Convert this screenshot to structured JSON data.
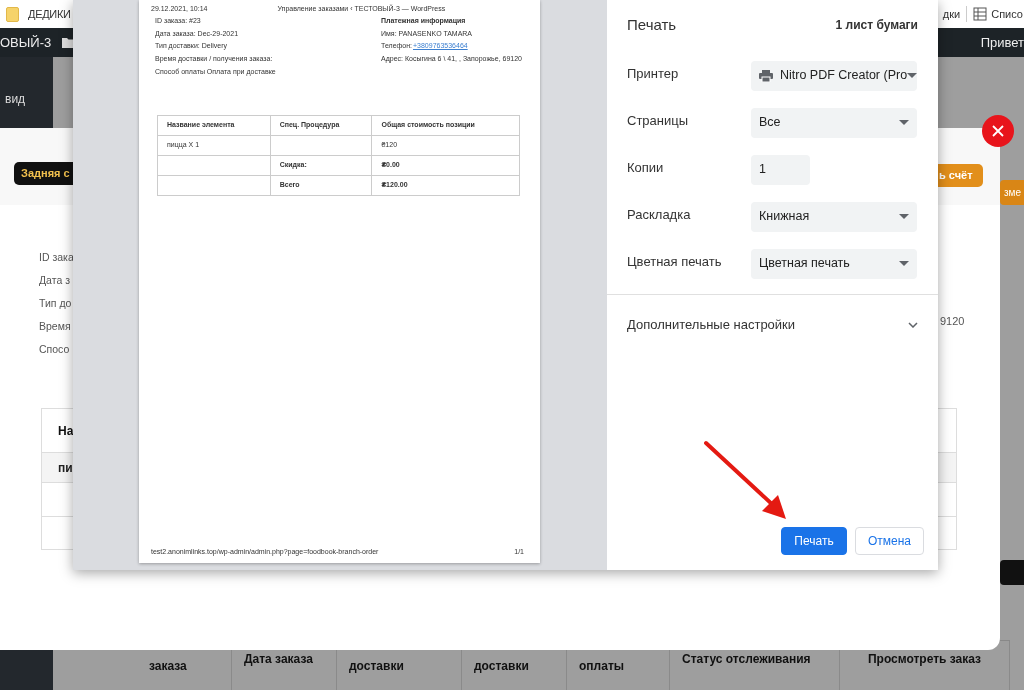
{
  "bookmarks_bar": {
    "folder": "ДЕДИКИ",
    "items": [
      "дки",
      "Списо"
    ]
  },
  "admin_bar": {
    "site_name": "ОВЫЙ-3",
    "greeting": "Привет"
  },
  "sidebar": {
    "items": [
      "вид"
    ]
  },
  "orders_table": {
    "columns": [
      "заказа",
      "Дата заказа",
      "доставки",
      "доставки",
      "оплаты",
      "Статус отслеживания",
      "Просмотреть заказ"
    ]
  },
  "page_buttons": [
    {
      "label": "зме",
      "kind": "orange"
    },
    {
      "kind": "dark"
    }
  ],
  "modal": {
    "buttons": [
      {
        "label": "Задняя с",
        "kind": "dark"
      },
      {
        "label": "ь счёт",
        "kind": "orange"
      }
    ],
    "details": [
      "ID зака",
      "Дата з",
      "Тип до",
      "Время",
      "Спосо"
    ],
    "address_tail": "9120",
    "table": {
      "header": "На",
      "rows": [
        "пи"
      ]
    }
  },
  "print_preview": {
    "header_date": "29.12.2021, 10:14",
    "header_title": "Управление заказами ‹ ТЕСТОВЫЙ-3 — WordPress",
    "order_lines": [
      "ID заказа: #23",
      "Дата заказа: Dec-29-2021",
      "Тип доставки: Delivery",
      "Время доставки / получения заказа:",
      "Способ оплаты Оплата при доставке"
    ],
    "billing": {
      "title": "Платежная информация",
      "name": "Имя: PANASENKO TAMARA",
      "phone_label": "Телефон:",
      "phone": "+3809763536464",
      "address": "Адрес: Косыгина 6 \\ 41, , Запорожье, 69120"
    },
    "table": {
      "columns": [
        "Название элемента",
        "Спец. Процедура",
        "Общая стоимость позиции"
      ],
      "rows": [
        {
          "kind": "item",
          "item": "пицца X 1",
          "price": "₴120"
        },
        {
          "kind": "total",
          "procedure": "Скидка:",
          "price": "₴0.00"
        },
        {
          "kind": "total",
          "procedure": "Всего",
          "price": "₴120.00"
        }
      ]
    },
    "footer_url": "test2.anonimlinks.top/wp-admin/admin.php?page=foodbook-branch-order",
    "page_number": "1/1"
  },
  "print_settings": {
    "title": "Печать",
    "sheets": "1 лист бумаги",
    "fields": [
      {
        "label": "Принтер",
        "kind": "printer",
        "value": "Nitro PDF Creator (Pro"
      },
      {
        "label": "Страницы",
        "kind": "select",
        "value": "Все"
      },
      {
        "label": "Копии",
        "kind": "input",
        "value": "1"
      },
      {
        "label": "Раскладка",
        "kind": "select",
        "value": "Книжная"
      },
      {
        "label": "Цветная печать",
        "kind": "select",
        "value": "Цветная печать"
      }
    ],
    "more_settings": {
      "label": "Дополнительные настройки",
      "expanded": false
    },
    "buttons": [
      {
        "label": "Печать",
        "kind": "primary"
      },
      {
        "label": "Отмена",
        "kind": "secondary"
      }
    ]
  }
}
